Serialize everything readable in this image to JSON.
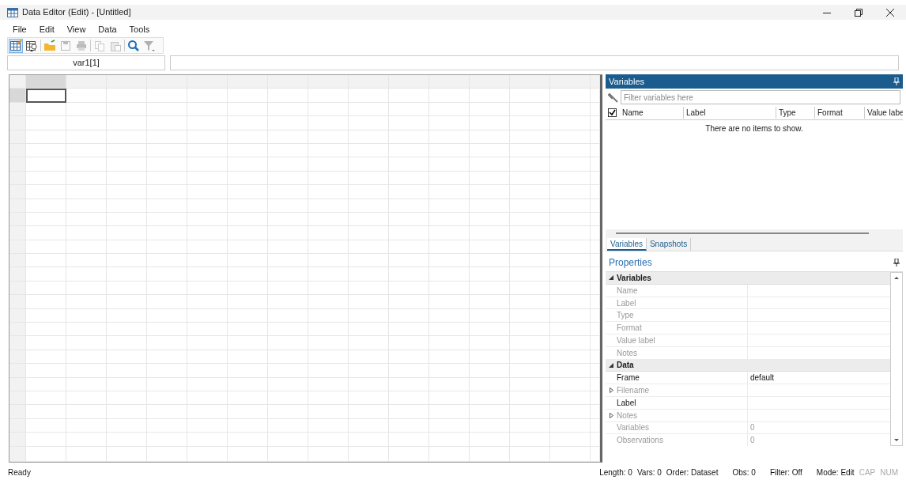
{
  "window": {
    "title": "Data Editor (Edit) - [Untitled]"
  },
  "menu": [
    "File",
    "Edit",
    "View",
    "Data",
    "Tools"
  ],
  "toolbar": [
    {
      "kind": "edit",
      "selected": true,
      "disabled": false
    },
    {
      "kind": "browse",
      "selected": false,
      "disabled": false
    },
    {
      "kind": "open",
      "selected": false,
      "disabled": false
    },
    {
      "kind": "save",
      "selected": false,
      "disabled": true
    },
    {
      "kind": "print",
      "selected": false,
      "disabled": true
    },
    {
      "kind": "copy",
      "selected": false,
      "disabled": true
    },
    {
      "kind": "paste",
      "selected": false,
      "disabled": true
    },
    {
      "kind": "find",
      "selected": false,
      "disabled": false
    },
    {
      "kind": "filter",
      "selected": false,
      "disabled": true
    }
  ],
  "cell_name": "var1[1]",
  "variables_panel": {
    "title": "Variables",
    "filter_placeholder": "Filter variables here",
    "select_all_checked": true,
    "columns": [
      "Name",
      "Label",
      "Type",
      "Format",
      "Value labe"
    ],
    "empty_message": "There are no items to show."
  },
  "tabs": [
    {
      "label": "Variables",
      "selected": true
    },
    {
      "label": "Snapshots",
      "selected": false
    }
  ],
  "properties": {
    "title": "Properties",
    "sections": [
      {
        "label": "Variables",
        "expanded": true,
        "rows": [
          {
            "label": "Name",
            "disabled": true,
            "expandable": false
          },
          {
            "label": "Label",
            "disabled": true,
            "expandable": false
          },
          {
            "label": "Type",
            "disabled": true,
            "expandable": false
          },
          {
            "label": "Format",
            "disabled": true,
            "expandable": false
          },
          {
            "label": "Value label",
            "disabled": true,
            "expandable": false
          },
          {
            "label": "Notes",
            "disabled": true,
            "expandable": false
          }
        ]
      },
      {
        "label": "Data",
        "expanded": true,
        "rows": [
          {
            "label": "Frame",
            "value": "default",
            "disabled": false,
            "expandable": false
          },
          {
            "label": "Filename",
            "disabled": true,
            "expandable": true
          },
          {
            "label": "Label",
            "disabled": false,
            "expandable": false
          },
          {
            "label": "Notes",
            "disabled": true,
            "expandable": true
          },
          {
            "label": "Variables",
            "value": "0",
            "disabled": true,
            "expandable": false
          },
          {
            "label": "Observations",
            "value": "0",
            "disabled": true,
            "expandable": false
          }
        ]
      }
    ]
  },
  "status_bar": {
    "message": "Ready",
    "items": [
      {
        "text": "Length: 0",
        "on": true
      },
      {
        "text": "Vars: 0",
        "on": true
      },
      {
        "text": "Order: Dataset",
        "on": true
      },
      {
        "text": "Obs: 0",
        "on": true
      },
      {
        "text": "Filter: Off",
        "on": true
      },
      {
        "text": "Mode: Edit",
        "on": true
      },
      {
        "text": "CAP",
        "on": false
      },
      {
        "text": "NUM",
        "on": false
      }
    ]
  }
}
